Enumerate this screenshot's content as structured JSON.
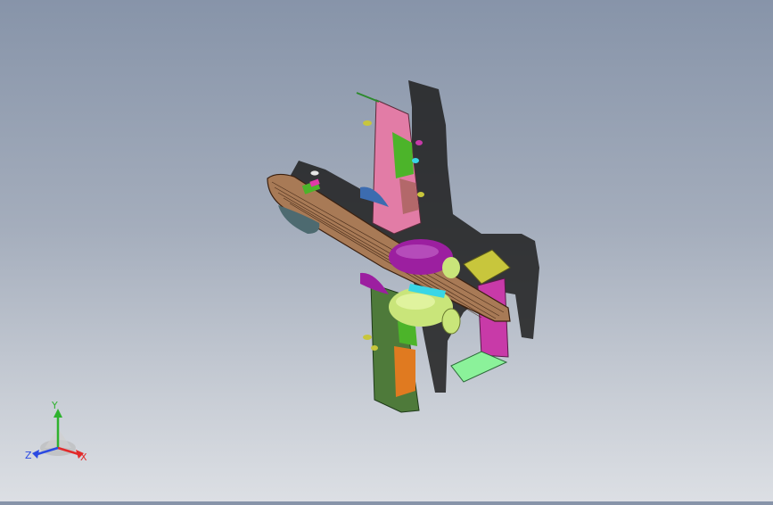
{
  "triad": {
    "x_label": "X",
    "y_label": "Y",
    "z_label": "Z",
    "x_color": "#e22b2b",
    "y_color": "#2fb22f",
    "z_color": "#2b4ae2"
  },
  "model": {
    "icons": [
      "aircraft-model"
    ],
    "colors": {
      "fuselage": "#a87a56",
      "wing_upper": "#e27ca6",
      "wing_lower": "#4e7a3a",
      "engine_top": "#9c1fa0",
      "engine_bottom": "#c9e57a",
      "tail_fin": "#c8c63c",
      "rudder": "#c83aa8",
      "stabilizer": "#8bf29a",
      "panel_orange": "#e07a20",
      "panel_green": "#4cb42a",
      "canopy": "#39d6e6"
    }
  }
}
